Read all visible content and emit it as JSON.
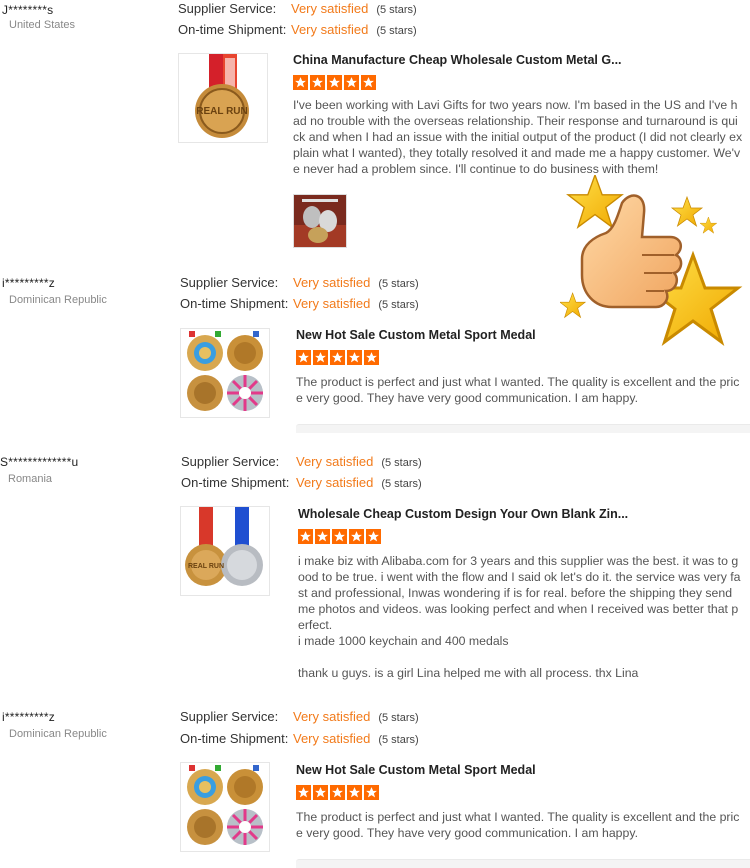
{
  "labels": {
    "supplier_service": "Supplier Service:",
    "on_time_shipment": "On-time Shipment:"
  },
  "reviews": [
    {
      "buyer": "J********s",
      "country": "United States",
      "supplier_service": "Very satisfied",
      "supplier_service_stars": "(5 stars)",
      "on_time_shipment": "Very satisfied",
      "on_time_shipment_stars": "(5 stars)",
      "product_title": "China Manufacture Cheap Wholesale Custom Metal G...",
      "rating": 5,
      "text": "I've been working with Lavi Gifts for two years now. I'm based in the US and I've had no trouble with the overseas relationship. Their response and turnaround is quick and when I had an issue with the initial output of the product (I did not clearly explain what I wanted), they totally resolved it and made me a happy customer. We've never had a problem since. I'll continue to do business with them!",
      "medal_text": "REAL RUN"
    },
    {
      "buyer": "i*********z",
      "country": "Dominican Republic",
      "supplier_service": "Very satisfied",
      "supplier_service_stars": "(5 stars)",
      "on_time_shipment": "Very satisfied",
      "on_time_shipment_stars": "(5 stars)",
      "product_title": "New Hot Sale Custom Metal Sport Medal",
      "rating": 5,
      "text": "The product is perfect and just what I wanted. The quality is excellent and the price very good. They have very good communication. I am happy."
    },
    {
      "buyer": "S*************u",
      "country": "Romania",
      "supplier_service": "Very satisfied",
      "supplier_service_stars": "(5 stars)",
      "on_time_shipment": "Very satisfied",
      "on_time_shipment_stars": "(5 stars)",
      "product_title": "Wholesale Cheap Custom Design Your Own Blank Zin...",
      "rating": 5,
      "text": "i make biz with Alibaba.com for 3 years and this supplier was the best. it was to good to be true. i went with the flow and I said ok let's do it. the service was very fast and professional, Inwas wondering if is for real. before the shipping they send me photos and videos. was looking perfect and when I received was better that perfect.",
      "text2": "i made 1000 keychain and 400 medals",
      "text3": "thank u guys. is a girl Lina helped me with all process. thx Lina",
      "medal_text": "REAL RUN"
    },
    {
      "buyer": "i*********z",
      "country": "Dominican Republic",
      "supplier_service": "Very satisfied",
      "supplier_service_stars": "(5 stars)",
      "on_time_shipment": "Very satisfied",
      "on_time_shipment_stars": "(5 stars)",
      "product_title": "New Hot Sale Custom Metal Sport Medal",
      "rating": 5,
      "text": "The product is perfect and just what I wanted. The quality is excellent and the price very good. They have very good communication. I am happy."
    }
  ],
  "decoration": {
    "icon": "thumbs-up-stars-icon"
  },
  "colors": {
    "accent": "#f27a1a",
    "star": "#ff6a00"
  }
}
